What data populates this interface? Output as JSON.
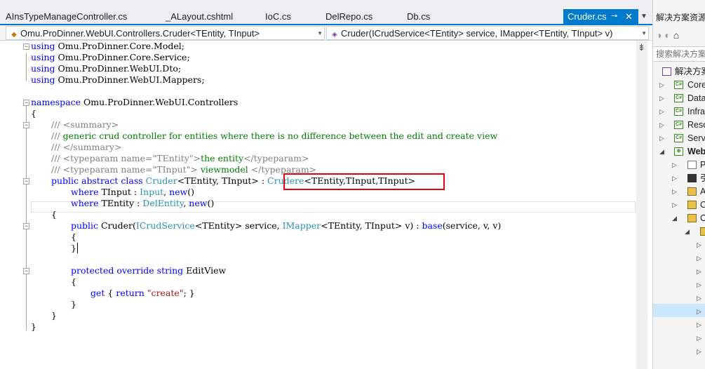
{
  "tabs": [
    {
      "label": "AInsTypeManageController.cs",
      "active": false
    },
    {
      "label": "_ALayout.cshtml",
      "active": false
    },
    {
      "label": "IoC.cs",
      "active": false
    },
    {
      "label": "DelRepo.cs",
      "active": false
    },
    {
      "label": "Db.cs",
      "active": false
    },
    {
      "label": "Cruder.cs",
      "active": true,
      "pin_icon": "pin-icon",
      "close_icon": "close-icon"
    }
  ],
  "tab_overflow_icon": "chevron-down-icon",
  "navigation_bar": {
    "type_dropdown": "Omu.ProDinner.WebUI.Controllers.Cruder<TEntity, TInput>",
    "member_dropdown": "Cruder(ICrudService<TEntity> service, IMapper<TEntity, TInput> v)"
  },
  "code": {
    "using_1": [
      "using",
      " Omu.ProDinner.Core.Model;"
    ],
    "using_2": [
      "using",
      " Omu.ProDinner.Core.Service;"
    ],
    "using_3": [
      "using",
      " Omu.ProDinner.WebUI.Dto;"
    ],
    "using_4": [
      "using",
      " Omu.ProDinner.WebUI.Mappers;"
    ],
    "namespace": [
      "namespace",
      " Omu.ProDinner.WebUI.Controllers"
    ],
    "ns_open": "{",
    "doc_1": [
      "/// ",
      "<summary>"
    ],
    "doc_2": [
      "/// ",
      "generic crud controller for entities where there is no difference between the edit and create view"
    ],
    "doc_3": [
      "/// ",
      "</summary>"
    ],
    "doc_4": [
      "/// ",
      "<typeparam name=\"TEntity\">",
      "the entity",
      "</typeparam>"
    ],
    "doc_5": [
      "/// ",
      "<typeparam name=\"TInput\">",
      " viewmodel ",
      "</typeparam>"
    ],
    "class_decl": [
      "public",
      " ",
      "abstract",
      " ",
      "class",
      " ",
      "Cruder",
      "<TEntity, TInput> : ",
      "Crudere",
      "<TEntity,TInput,TInput>"
    ],
    "where_1": [
      "where",
      " TInput : ",
      "Input",
      ", ",
      "new",
      "()"
    ],
    "where_2": [
      "where",
      " TEntity : ",
      "DelEntity",
      ", ",
      "new",
      "()"
    ],
    "class_open": "{",
    "ctor": [
      "public",
      " Cruder(",
      "ICrudService",
      "<TEntity> service, ",
      "IMapper",
      "<TEntity, TInput> v) : ",
      "base",
      "(service, v, v)"
    ],
    "ctor_open": "{",
    "ctor_close": "}",
    "method": [
      "protected",
      " ",
      "override",
      " ",
      "string",
      " EditView"
    ],
    "method_open": "{",
    "getter": [
      "get",
      " { ",
      "return",
      " ",
      "\"create\"",
      "; }"
    ],
    "method_close": "}",
    "class_close": "}",
    "ns_close": "}"
  },
  "annotation": {
    "color": "#e8000d"
  },
  "scrollbar": {
    "split_icon": "split-icon"
  },
  "solution_explorer": {
    "title": "解决方案资源",
    "toolbar_icons": [
      "back-icon",
      "forward-icon",
      "home-icon"
    ],
    "search_placeholder": "搜索解决方案",
    "solution_label": "解决方案",
    "items": [
      {
        "label": "Core",
        "icon": "csharp-project-icon",
        "icon_text": "C#"
      },
      {
        "label": "Data",
        "icon": "csharp-project-icon",
        "icon_text": "C#"
      },
      {
        "label": "Infra",
        "icon": "csharp-project-icon",
        "icon_text": "C#"
      },
      {
        "label": "Reso",
        "icon": "csharp-project-icon",
        "icon_text": "C#"
      },
      {
        "label": "Serv",
        "icon": "csharp-project-icon",
        "icon_text": "C#"
      },
      {
        "label": "Web",
        "icon": "web-project-icon",
        "icon_text": "⊕"
      },
      {
        "label": "P",
        "icon": "properties-icon",
        "icon_text": ""
      },
      {
        "label": "引",
        "icon": "references-icon",
        "icon_text": ""
      },
      {
        "label": "A",
        "icon": "folder-icon",
        "icon_text": ""
      },
      {
        "label": "C",
        "icon": "folder-icon",
        "icon_text": ""
      },
      {
        "label": "C",
        "icon": "folder-icon",
        "icon_text": ""
      }
    ]
  }
}
